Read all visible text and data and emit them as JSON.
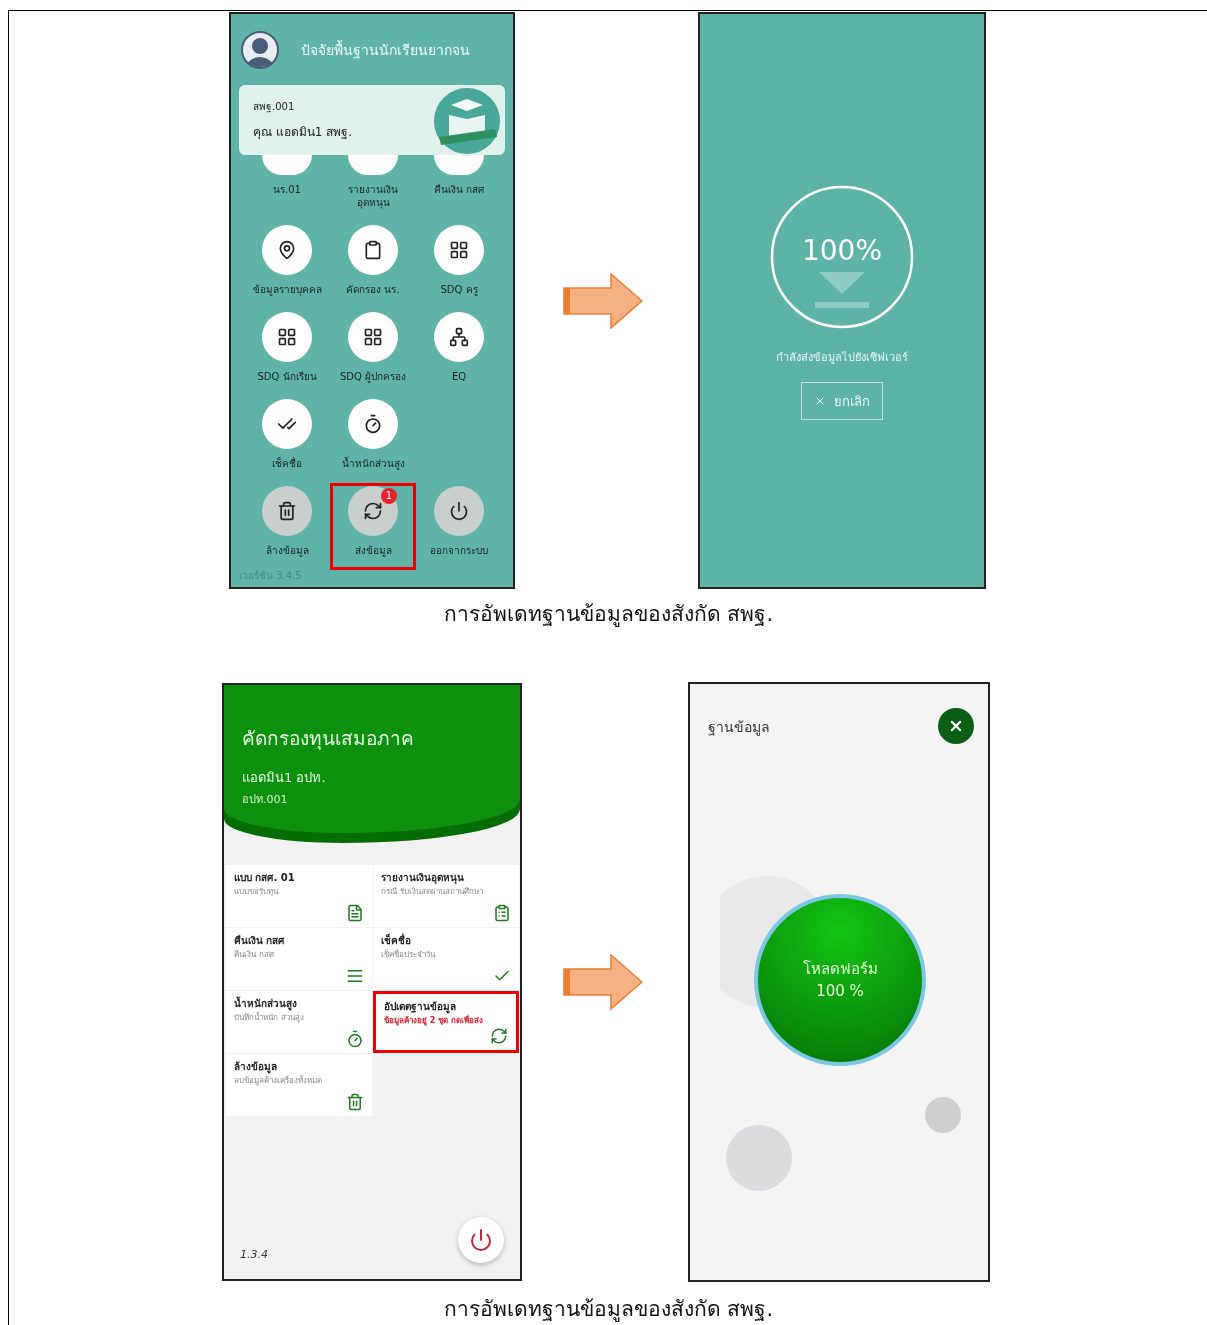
{
  "figure_1": {
    "phone_menu": {
      "title": "ปัจจัยพื้นฐานนักเรียนยากจน",
      "account": {
        "code": "สพฐ.001",
        "name": "คุณ แอดมิน1 สพฐ."
      },
      "menu": [
        {
          "label": "นร.01",
          "selected": false
        },
        {
          "label": "รายงานเงินอุดหนุน",
          "selected": false
        },
        {
          "label": "คืนเงิน กสศ",
          "selected": false
        },
        {
          "label": "ข้อมูลรายบุคคล",
          "selected": false
        },
        {
          "label": "คัดกรอง นร.",
          "selected": false
        },
        {
          "label": "SDQ ครู",
          "selected": false
        },
        {
          "label": "SDQ นักเรียน",
          "selected": false
        },
        {
          "label": "SDQ ผู้ปกครอง",
          "selected": false
        },
        {
          "label": "EQ",
          "selected": false
        },
        {
          "label": "เช็คชื่อ",
          "selected": false
        },
        {
          "label": "น้ำหนักส่วนสูง",
          "selected": false
        }
      ],
      "actions": [
        {
          "label": "ล้างข้อมูล",
          "selected": false
        },
        {
          "label": "ส่งข้อมูล",
          "selected": true,
          "badge": "1"
        },
        {
          "label": "ออกจากระบบ",
          "selected": false
        }
      ],
      "version": "เวอร์ชัน 3.4.5"
    },
    "phone_upload": {
      "progress": {
        "text": "100%",
        "level": 1
      },
      "status": "กำลังส่งข้อมูลไปยังเซิฟเวอร์",
      "cancel_button": "ยกเลิก"
    },
    "caption": "การอัพเดทฐานข้อมูลของสังกัด สพฐ."
  },
  "figure_2": {
    "phone_screening": {
      "title": "คัดกรองทุนเสมอภาค",
      "user": "แอดมิน1 อปท.",
      "code": "อปท.001",
      "tiles": [
        {
          "title": "แบบ กสศ. 01",
          "subtitle": "แบบขอรับทุน",
          "selected": false,
          "warning": false
        },
        {
          "title": "รายงานเงินอุดหนุน",
          "subtitle": "กรณี รับเงินสดผ่านสถานศึกษา",
          "selected": false,
          "warning": false
        },
        {
          "title": "คืนเงิน กสศ",
          "subtitle": "คืนเงิน กสศ",
          "selected": false,
          "warning": false
        },
        {
          "title": "เช็คชื่อ",
          "subtitle": "เช็คชื่อประจำวัน",
          "selected": false,
          "warning": false
        },
        {
          "title": "น้ำหนักส่วนสูง",
          "subtitle": "บันทึกน้ำหนัก ส่วนสูง",
          "selected": false,
          "warning": false
        },
        {
          "title": "อัปเดตฐานข้อมูล",
          "subtitle": "ข้อมูลค้างอยู่ 2 ชุด กดเพื่อส่ง",
          "selected": true,
          "warning": true
        },
        {
          "title": "ล้างข้อมูล",
          "subtitle": "ลบข้อมูลค้างเครื่องทั้งหมด",
          "selected": false,
          "warning": false
        }
      ],
      "version": "1.3.4"
    },
    "phone_download": {
      "title": "ฐานข้อมูล",
      "status": "โหลดฟอร์ม",
      "percent": "100 %"
    },
    "caption": "การอัพเดทฐานข้อมูลของสังกัด สพฐ."
  }
}
